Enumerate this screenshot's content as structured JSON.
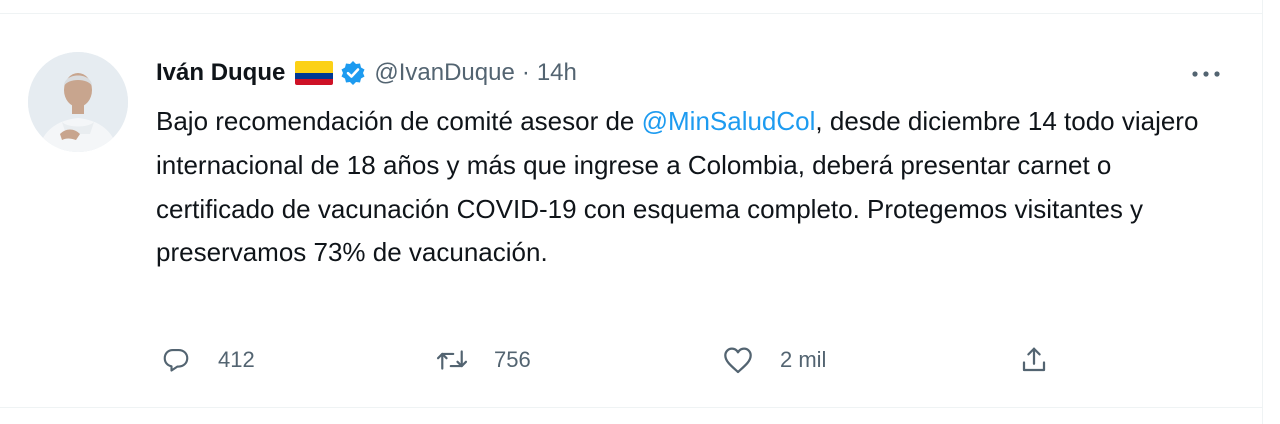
{
  "tweet": {
    "display_name": "Iván Duque",
    "handle": "@IvanDuque",
    "separator": "·",
    "time": "14h",
    "text_part1": "Bajo recomendación de comité asesor de ",
    "mention": "@MinSaludCol",
    "text_part2": ", desde diciembre 14 todo viajero internacional de 18 años y más que ingrese a Colombia, deberá presentar carnet o certificado de vacunación COVID-19 con esquema completo. Protegemos visitantes y preservamos 73% de vacunación."
  },
  "actions": {
    "reply": {
      "icon": "reply-icon",
      "count": "412"
    },
    "retweet": {
      "icon": "retweet-icon",
      "count": "756"
    },
    "like": {
      "icon": "heart-icon",
      "count": "2 mil"
    },
    "share": {
      "icon": "share-icon"
    }
  },
  "colors": {
    "text": "#0f1419",
    "secondary": "#536471",
    "link": "#1d9bf0",
    "verified": "#1d9bf0",
    "flag_yellow": "#fcd116",
    "flag_blue": "#003893",
    "flag_red": "#ce1126"
  }
}
